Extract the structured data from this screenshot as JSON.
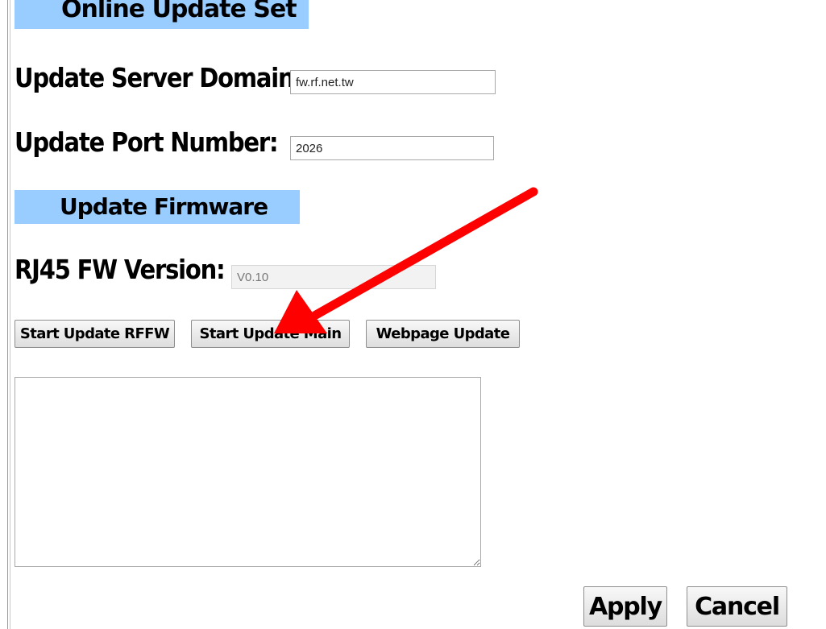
{
  "online_update_set": {
    "title": "Online Update Set",
    "server_domain": {
      "label": "Update Server Domain:",
      "value": "fw.rf.net.tw"
    },
    "port_number": {
      "label": "Update Port Number:",
      "value": "2026"
    }
  },
  "update_firmware": {
    "title": "Update Firmware",
    "rj45_version": {
      "label": "RJ45 FW Version:",
      "value": "V0.10"
    },
    "buttons": {
      "rffw": "Start Update RFFW",
      "main": "Start Update Main",
      "webpage": "Webpage Update"
    },
    "log_text": ""
  },
  "footer": {
    "apply": "Apply",
    "cancel": "Cancel"
  },
  "annotation": {
    "arrow_color": "#ff0000"
  }
}
